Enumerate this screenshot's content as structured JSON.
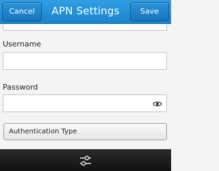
{
  "titlebar": {
    "title": "APN Settings",
    "cancel_label": "Cancel",
    "save_label": "Save",
    "accent_color": "#1a83cc"
  },
  "form": {
    "username_label": "Username",
    "username_value": "",
    "password_label": "Password",
    "password_value": "",
    "auth_type_label": "Authentication Type"
  },
  "icons": {
    "password_toggle": "eye-icon",
    "bottom_action": "settings-sliders-icon"
  }
}
